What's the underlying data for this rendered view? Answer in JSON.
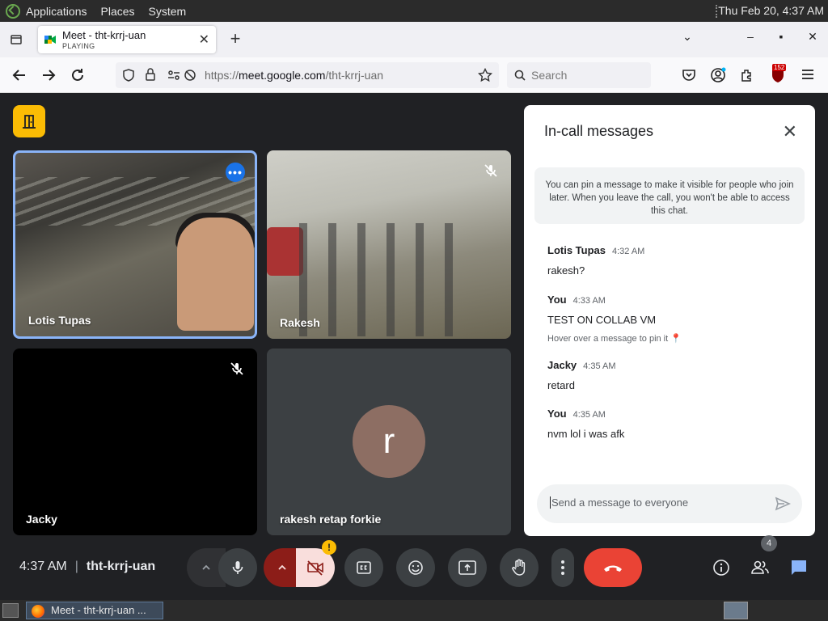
{
  "system": {
    "menus": [
      "Applications",
      "Places",
      "System"
    ],
    "clock": "Thu Feb 20,  4:37 AM"
  },
  "browser": {
    "tab": {
      "title": "Meet - tht-krrj-uan",
      "status": "PLAYING"
    },
    "url_prefix": "https://",
    "url_domain": "meet.google.com",
    "url_path": "/tht-krrj-uan",
    "search_placeholder": "Search",
    "extension_badge": "152"
  },
  "meet": {
    "tiles": [
      {
        "name": "Lotis Tupas"
      },
      {
        "name": "Rakesh"
      },
      {
        "name": "Jacky"
      },
      {
        "name": "rakesh retap forkie",
        "avatar_letter": "r"
      }
    ],
    "chat": {
      "title": "In-call messages",
      "info": "You can pin a message to make it visible for people who join later. When you leave the call, you won't be able to access this chat.",
      "messages": [
        {
          "sender": "Lotis Tupas",
          "time": "4:32 AM",
          "text": "rakesh?"
        },
        {
          "sender": "You",
          "time": "4:33 AM",
          "text": "TEST ON COLLAB VM",
          "hint": "Hover over a message to pin it"
        },
        {
          "sender": "Jacky",
          "time": "4:35 AM",
          "text": "retard"
        },
        {
          "sender": "You",
          "time": "4:35 AM",
          "text": "nvm lol i was afk"
        }
      ],
      "input_placeholder": "Send a message to everyone"
    },
    "meeting_time": "4:37 AM",
    "meeting_code": "tht-krrj-uan",
    "warning_mark": "!",
    "participants_count": "4"
  },
  "taskbar": {
    "window_title": "Meet - tht-krrj-uan ..."
  },
  "colors": {
    "accent_blue": "#8ab4f8",
    "end_call_red": "#ea4335",
    "door_yellow": "#fbbc04",
    "avatar_brown": "#8d6e63"
  }
}
